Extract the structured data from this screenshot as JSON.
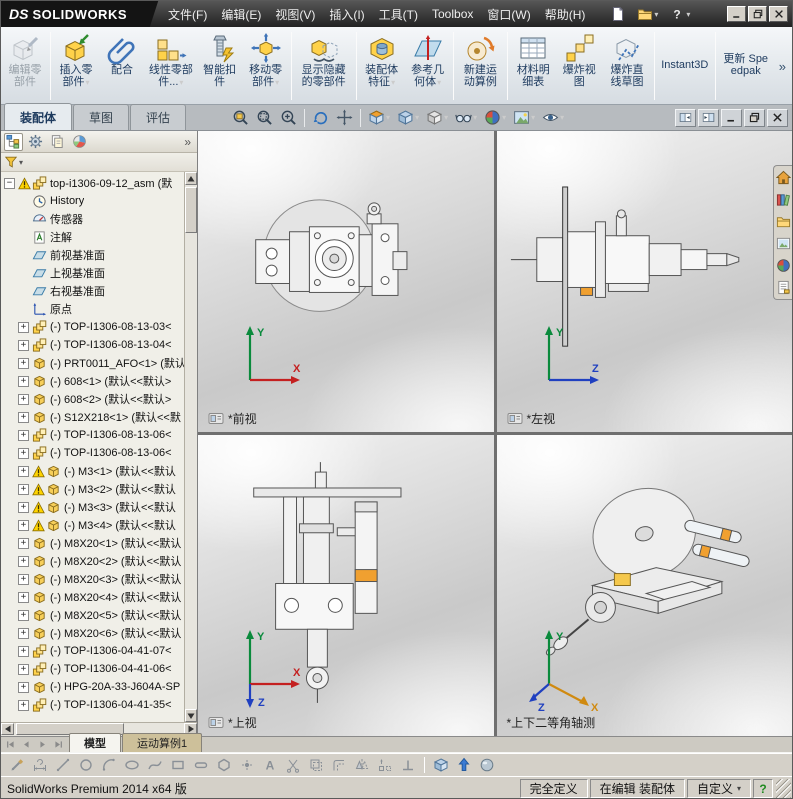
{
  "titlebar": {
    "brand_prefix": "DS",
    "brand": "SOLIDWORKS",
    "menus": [
      {
        "name": "menu-file",
        "label": "文件(F)"
      },
      {
        "name": "menu-edit",
        "label": "编辑(E)"
      },
      {
        "name": "menu-view",
        "label": "视图(V)"
      },
      {
        "name": "menu-insert",
        "label": "插入(I)"
      },
      {
        "name": "menu-tools",
        "label": "工具(T)"
      },
      {
        "name": "menu-toolbox",
        "label": "Toolbox"
      },
      {
        "name": "menu-window",
        "label": "窗口(W)"
      },
      {
        "name": "menu-help",
        "label": "帮助(H)"
      }
    ],
    "quick_icons": [
      {
        "name": "new-document-button",
        "icon": "new-document-icon"
      },
      {
        "name": "open-document-button",
        "icon": "open-document-icon",
        "dropdown": true
      },
      {
        "name": "help-button",
        "icon": "help-icon",
        "dropdown": true
      }
    ]
  },
  "window_controls": [
    {
      "name": "minimize-button",
      "icon": "minimize-icon"
    },
    {
      "name": "restore-button",
      "icon": "restore-icon"
    },
    {
      "name": "close-button",
      "icon": "close-icon"
    }
  ],
  "ribbon": {
    "overflow": "»",
    "buttons": [
      {
        "name": "edit-component-button",
        "icon": "edit-component-icon",
        "label": "编辑零部件",
        "disabled": true,
        "sep_after": true
      },
      {
        "name": "insert-components-button",
        "icon": "insert-component-icon",
        "label": "插入零部件",
        "dropdown": true
      },
      {
        "name": "mate-button",
        "icon": "mate-icon",
        "label": "配合"
      },
      {
        "name": "linear-component-pattern-button",
        "icon": "linear-component-pattern-icon",
        "label": "线性零部件...",
        "dropdown": true
      },
      {
        "name": "smart-fasteners-button",
        "icon": "smart-fasteners-icon",
        "label": "智能扣件"
      },
      {
        "name": "move-component-button",
        "icon": "move-component-icon",
        "label": "移动零部件",
        "dropdown": true,
        "sep_after": true
      },
      {
        "name": "show-hidden-components-button",
        "icon": "show-hidden-components-icon",
        "label": "显示隐藏的零部件",
        "sep_after": true
      },
      {
        "name": "assembly-features-button",
        "icon": "assembly-features-icon",
        "label": "装配体特征",
        "dropdown": true
      },
      {
        "name": "reference-geometry-button",
        "icon": "reference-geometry-icon",
        "label": "参考几何体",
        "dropdown": true,
        "sep_after": true
      },
      {
        "name": "new-motion-study-button",
        "icon": "new-motion-study-icon",
        "label": "新建运动算例",
        "sep_after": true
      },
      {
        "name": "bill-of-materials-button",
        "icon": "bill-of-materials-icon",
        "label": "材料明细表"
      },
      {
        "name": "exploded-view-button",
        "icon": "exploded-view-icon",
        "label": "爆炸视图"
      },
      {
        "name": "explode-line-sketch-button",
        "icon": "explode-line-sketch-icon",
        "label": "爆炸直线草图",
        "sep_after": true
      },
      {
        "name": "instant3d-button",
        "icon": null,
        "label": "Instant3D",
        "sep_after": true
      },
      {
        "name": "update-speedpak-button",
        "icon": null,
        "label": "更新 Speedpak"
      }
    ]
  },
  "command_tabs": [
    {
      "name": "tab-assembly",
      "label": "装配体",
      "active": true
    },
    {
      "name": "tab-sketch",
      "label": "草图",
      "active": false
    },
    {
      "name": "tab-evaluate",
      "label": "评估",
      "active": false
    }
  ],
  "heads_up": [
    {
      "name": "zoom-fit-button",
      "icon": "zoom-fit-icon"
    },
    {
      "name": "zoom-area-button",
      "icon": "zoom-area-icon"
    },
    {
      "name": "zoom-in-out-button",
      "icon": "zoom-in-out-icon",
      "sep_after": true
    },
    {
      "name": "rotate-view-button",
      "icon": "rotate-view-icon"
    },
    {
      "name": "pan-button",
      "icon": "pan-icon",
      "sep_after": true
    },
    {
      "name": "section-view-button",
      "icon": "section-view-icon",
      "dropdown": true
    },
    {
      "name": "view-orientation-button",
      "icon": "view-orientation-icon",
      "dropdown": true
    },
    {
      "name": "display-style-button",
      "icon": "display-style-icon",
      "dropdown": true
    },
    {
      "name": "hide-show-items-button",
      "icon": "hide-show-items-icon",
      "dropdown": true
    },
    {
      "name": "edit-appearance-button",
      "icon": "edit-appearance-icon",
      "dropdown": true
    },
    {
      "name": "apply-scene-button",
      "icon": "apply-scene-icon",
      "dropdown": true
    },
    {
      "name": "view-settings-button",
      "icon": "view-settings-icon",
      "dropdown": true
    }
  ],
  "doc_controls": [
    {
      "name": "split-left-button",
      "icon": "split-left-icon"
    },
    {
      "name": "split-right-button",
      "icon": "split-right-icon"
    },
    {
      "name": "doc-minimize-button",
      "icon": "minimize-icon"
    },
    {
      "name": "doc-restore-button",
      "icon": "restore-icon"
    },
    {
      "name": "doc-close-button",
      "icon": "close-icon"
    }
  ],
  "feature_panel": {
    "overflow": "»",
    "tabs": [
      {
        "name": "featuremanager-tab",
        "icon": "featuremanager-tab-icon",
        "active": true
      },
      {
        "name": "propertymanager-tab",
        "icon": "propertymanager-tab-icon",
        "active": false
      },
      {
        "name": "configurationmanager-tab",
        "icon": "configurationmanager-tab-icon",
        "active": false
      },
      {
        "name": "displaymanager-tab",
        "icon": "displaymanager-tab-icon",
        "active": false
      }
    ],
    "tree": [
      {
        "label": "top-i1306-09-12_asm (默",
        "icon": "assembly-icon",
        "warn": true,
        "expand": "minus",
        "level": 0
      },
      {
        "label": "History",
        "icon": "history-icon",
        "level": 1
      },
      {
        "label": "传感器",
        "icon": "sensors-icon",
        "level": 1
      },
      {
        "label": "注解",
        "icon": "annotations-icon",
        "level": 1
      },
      {
        "label": "前视基准面",
        "icon": "plane-icon",
        "level": 1
      },
      {
        "label": "上视基准面",
        "icon": "plane-icon",
        "level": 1
      },
      {
        "label": "右视基准面",
        "icon": "plane-icon",
        "level": 1
      },
      {
        "label": "原点",
        "icon": "origin-icon",
        "level": 1
      },
      {
        "label": "(-) TOP-I1306-08-13-03<",
        "icon": "assembly-icon",
        "expand": "plus",
        "level": 1
      },
      {
        "label": "(-) TOP-I1306-08-13-04<",
        "icon": "assembly-icon",
        "expand": "plus",
        "level": 1
      },
      {
        "label": "(-) PRT0011_AFO<1> (默认",
        "icon": "part-icon",
        "expand": "plus",
        "level": 1
      },
      {
        "label": "(-) 608<1> (默认<<默认>",
        "icon": "part-icon",
        "expand": "plus",
        "level": 1
      },
      {
        "label": "(-) 608<2> (默认<<默认>",
        "icon": "part-icon",
        "expand": "plus",
        "level": 1
      },
      {
        "label": "(-) S12X218<1> (默认<<默",
        "icon": "part-icon",
        "expand": "plus",
        "level": 1
      },
      {
        "label": "(-) TOP-I1306-08-13-06<",
        "icon": "assembly-icon",
        "expand": "plus",
        "level": 1
      },
      {
        "label": "(-) TOP-I1306-08-13-06<",
        "icon": "assembly-icon",
        "expand": "plus",
        "level": 1
      },
      {
        "label": "(-) M3<1> (默认<<默认",
        "icon": "part-icon",
        "warn": true,
        "expand": "plus",
        "level": 1
      },
      {
        "label": "(-) M3<2> (默认<<默认",
        "icon": "part-icon",
        "warn": true,
        "expand": "plus",
        "level": 1
      },
      {
        "label": "(-) M3<3> (默认<<默认",
        "icon": "part-icon",
        "warn": true,
        "expand": "plus",
        "level": 1
      },
      {
        "label": "(-) M3<4> (默认<<默认",
        "icon": "part-icon",
        "warn": true,
        "expand": "plus",
        "level": 1
      },
      {
        "label": "(-) M8X20<1> (默认<<默认",
        "icon": "part-icon",
        "expand": "plus",
        "level": 1
      },
      {
        "label": "(-) M8X20<2> (默认<<默认",
        "icon": "part-icon",
        "expand": "plus",
        "level": 1
      },
      {
        "label": "(-) M8X20<3> (默认<<默认",
        "icon": "part-icon",
        "expand": "plus",
        "level": 1
      },
      {
        "label": "(-) M8X20<4> (默认<<默认",
        "icon": "part-icon",
        "expand": "plus",
        "level": 1
      },
      {
        "label": "(-) M8X20<5> (默认<<默认",
        "icon": "part-icon",
        "expand": "plus",
        "level": 1
      },
      {
        "label": "(-) M8X20<6> (默认<<默认",
        "icon": "part-icon",
        "expand": "plus",
        "level": 1
      },
      {
        "label": "(-) TOP-I1306-04-41-07<",
        "icon": "assembly-icon",
        "expand": "plus",
        "level": 1
      },
      {
        "label": "(-) TOP-I1306-04-41-06<",
        "icon": "assembly-icon",
        "expand": "plus",
        "level": 1
      },
      {
        "label": "(-) HPG-20A-33-J604A-SP",
        "icon": "part-icon",
        "expand": "plus",
        "level": 1
      },
      {
        "label": "(-) TOP-I1306-04-41-35<",
        "icon": "assembly-icon",
        "expand": "plus",
        "level": 1
      }
    ]
  },
  "viewports": [
    {
      "id": "front",
      "label": "*前视",
      "flag": true,
      "axes": [
        {
          "label": "Y",
          "color": "#0a8a3c",
          "dir": "up"
        },
        {
          "label": "X",
          "color": "#c42020",
          "dir": "right"
        }
      ]
    },
    {
      "id": "left",
      "label": "*左视",
      "flag": true,
      "axes": [
        {
          "label": "Y",
          "color": "#0a8a3c",
          "dir": "up"
        },
        {
          "label": "Z",
          "color": "#2040c0",
          "dir": "right"
        }
      ]
    },
    {
      "id": "top",
      "label": "*上视",
      "flag": true,
      "axes": [
        {
          "label": "Y",
          "color": "#0a8a3c",
          "dir": "up"
        },
        {
          "label": "X",
          "color": "#c42020",
          "dir": "right"
        },
        {
          "label": "Z",
          "color": "#2040c0",
          "dir": "down"
        }
      ]
    },
    {
      "id": "iso",
      "label": "*上下二等角轴测",
      "flag": false,
      "axes": [
        {
          "label": "Y",
          "color": "#0a8a3c",
          "dir": "up"
        },
        {
          "label": "X",
          "color": "#d08a10",
          "dir": "down-right"
        },
        {
          "label": "Z",
          "color": "#2040c0",
          "dir": "down-left"
        }
      ]
    }
  ],
  "task_pane": [
    {
      "name": "solidworks-resources-tab",
      "icon": "solidworks-resources-icon"
    },
    {
      "name": "design-library-tab",
      "icon": "design-library-icon"
    },
    {
      "name": "file-explorer-tab",
      "icon": "file-explorer-icon"
    },
    {
      "name": "view-palette-tab",
      "icon": "view-palette-icon"
    },
    {
      "name": "appearances-tab",
      "icon": "appearances-icon"
    },
    {
      "name": "custom-properties-tab",
      "icon": "custom-properties-icon"
    }
  ],
  "model_tabs": {
    "nav": [
      {
        "name": "first-tab-button",
        "icon": "nav-first-icon"
      },
      {
        "name": "prev-tab-button",
        "icon": "nav-prev-icon"
      },
      {
        "name": "next-tab-button",
        "icon": "nav-next-icon"
      },
      {
        "name": "last-tab-button",
        "icon": "nav-last-icon"
      }
    ],
    "tabs": [
      {
        "name": "tab-model",
        "label": "模型",
        "active": true
      },
      {
        "name": "tab-motion-study",
        "label": "运动算例1",
        "active": false
      }
    ]
  },
  "sketch_toolbar": [
    {
      "name": "sketch-button",
      "icon": "sketch-icon"
    },
    {
      "name": "smart-dimension-button",
      "icon": "smart-dimension-icon"
    },
    {
      "name": "line-button",
      "icon": "line-icon"
    },
    {
      "name": "circle-button",
      "icon": "circle-icon"
    },
    {
      "name": "arc-button",
      "icon": "arc-icon"
    },
    {
      "name": "ellipse-button",
      "icon": "ellipse-icon"
    },
    {
      "name": "spline-button",
      "icon": "spline-icon"
    },
    {
      "name": "rectangle-button",
      "icon": "rectangle-icon"
    },
    {
      "name": "slot-button",
      "icon": "slot-icon"
    },
    {
      "name": "polygon-button",
      "icon": "polygon-icon"
    },
    {
      "name": "point-button",
      "icon": "point-icon"
    },
    {
      "name": "text-button",
      "icon": "text-icon"
    },
    {
      "name": "trim-entities-button",
      "icon": "trim-entities-icon"
    },
    {
      "name": "convert-entities-button",
      "icon": "convert-entities-icon"
    },
    {
      "name": "offset-entities-button",
      "icon": "offset-entities-icon"
    },
    {
      "name": "mirror-entities-button",
      "icon": "mirror-entities-icon"
    },
    {
      "name": "linear-sketch-pattern-button",
      "icon": "linear-sketch-pattern-icon"
    },
    {
      "name": "display-relations-button",
      "icon": "display-relations-icon"
    },
    {
      "name": "view-cube-button",
      "icon": "view-cube-icon",
      "sep_before": true
    },
    {
      "name": "instant3d-arrow-button",
      "icon": "instant3d-arrow-icon"
    },
    {
      "name": "render-sphere-button",
      "icon": "render-sphere-icon"
    }
  ],
  "status_bar": {
    "left": "SolidWorks Premium 2014 x64 版",
    "cells": [
      {
        "name": "definition-status",
        "text": "完全定义",
        "interactable": false
      },
      {
        "name": "edit-mode-status",
        "text": "在编辑 装配体",
        "interactable": false
      },
      {
        "name": "customize-menu",
        "text": "自定义",
        "dropdown": true,
        "interactable": true
      }
    ],
    "help": "?"
  }
}
